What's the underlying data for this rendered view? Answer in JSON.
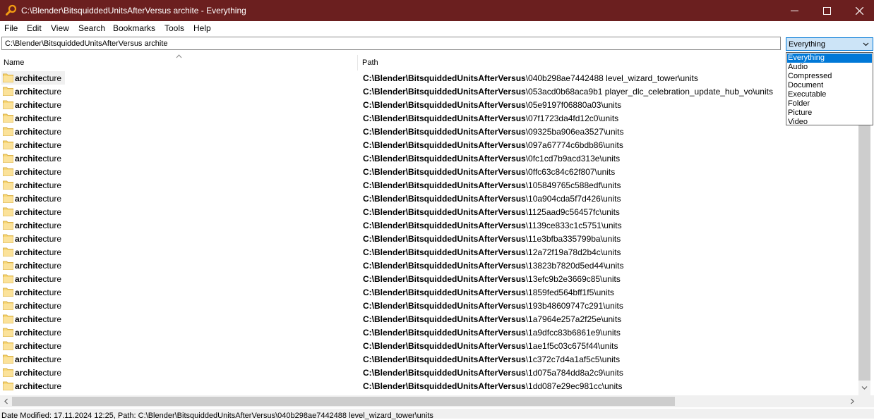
{
  "window": {
    "title": "C:\\Blender\\BitsquiddedUnitsAfterVersus archite - Everything",
    "minimize_label": "—",
    "maximize_label": "☐",
    "close_label": "✕",
    "icon": "search-magnifier-icon",
    "accent_color": "#6b1f1f"
  },
  "menu": {
    "items": [
      "File",
      "Edit",
      "View",
      "Search",
      "Bookmarks",
      "Tools",
      "Help"
    ]
  },
  "search": {
    "value": "C:\\Blender\\BitsquiddedUnitsAfterVersus archite"
  },
  "filter": {
    "selected": "Everything",
    "options": [
      "Everything",
      "Audio",
      "Compressed",
      "Document",
      "Executable",
      "Folder",
      "Picture",
      "Video"
    ]
  },
  "columns": {
    "name": "Name",
    "path": "Path"
  },
  "rows": [
    {
      "name_match": "archite",
      "name_rest": "cture",
      "path_match": "C:\\Blender\\BitsquiddedUnitsAfterVersus",
      "path_rest": "\\040b298ae7442488 level_wizard_tower\\units"
    },
    {
      "name_match": "archite",
      "name_rest": "cture",
      "path_match": "C:\\Blender\\BitsquiddedUnitsAfterVersus",
      "path_rest": "\\053acd0b68aca9b1 player_dlc_celebration_update_hub_vo\\units"
    },
    {
      "name_match": "archite",
      "name_rest": "cture",
      "path_match": "C:\\Blender\\BitsquiddedUnitsAfterVersus",
      "path_rest": "\\05e9197f06880a03\\units"
    },
    {
      "name_match": "archite",
      "name_rest": "cture",
      "path_match": "C:\\Blender\\BitsquiddedUnitsAfterVersus",
      "path_rest": "\\07f1723da4fd12c0\\units"
    },
    {
      "name_match": "archite",
      "name_rest": "cture",
      "path_match": "C:\\Blender\\BitsquiddedUnitsAfterVersus",
      "path_rest": "\\09325ba906ea3527\\units"
    },
    {
      "name_match": "archite",
      "name_rest": "cture",
      "path_match": "C:\\Blender\\BitsquiddedUnitsAfterVersus",
      "path_rest": "\\097a67774c6bdb86\\units"
    },
    {
      "name_match": "archite",
      "name_rest": "cture",
      "path_match": "C:\\Blender\\BitsquiddedUnitsAfterVersus",
      "path_rest": "\\0fc1cd7b9acd313e\\units"
    },
    {
      "name_match": "archite",
      "name_rest": "cture",
      "path_match": "C:\\Blender\\BitsquiddedUnitsAfterVersus",
      "path_rest": "\\0ffc63c84c62f807\\units"
    },
    {
      "name_match": "archite",
      "name_rest": "cture",
      "path_match": "C:\\Blender\\BitsquiddedUnitsAfterVersus",
      "path_rest": "\\105849765c588edf\\units"
    },
    {
      "name_match": "archite",
      "name_rest": "cture",
      "path_match": "C:\\Blender\\BitsquiddedUnitsAfterVersus",
      "path_rest": "\\10a904cda5f7d426\\units"
    },
    {
      "name_match": "archite",
      "name_rest": "cture",
      "path_match": "C:\\Blender\\BitsquiddedUnitsAfterVersus",
      "path_rest": "\\1125aad9c56457fc\\units"
    },
    {
      "name_match": "archite",
      "name_rest": "cture",
      "path_match": "C:\\Blender\\BitsquiddedUnitsAfterVersus",
      "path_rest": "\\1139ce833c1c5751\\units"
    },
    {
      "name_match": "archite",
      "name_rest": "cture",
      "path_match": "C:\\Blender\\BitsquiddedUnitsAfterVersus",
      "path_rest": "\\11e3bfba335799ba\\units"
    },
    {
      "name_match": "archite",
      "name_rest": "cture",
      "path_match": "C:\\Blender\\BitsquiddedUnitsAfterVersus",
      "path_rest": "\\12a72f19a78d2b4c\\units"
    },
    {
      "name_match": "archite",
      "name_rest": "cture",
      "path_match": "C:\\Blender\\BitsquiddedUnitsAfterVersus",
      "path_rest": "\\13823b7820d5ed44\\units"
    },
    {
      "name_match": "archite",
      "name_rest": "cture",
      "path_match": "C:\\Blender\\BitsquiddedUnitsAfterVersus",
      "path_rest": "\\13efc9b2e3669c85\\units"
    },
    {
      "name_match": "archite",
      "name_rest": "cture",
      "path_match": "C:\\Blender\\BitsquiddedUnitsAfterVersus",
      "path_rest": "\\1859fed564bff1f5\\units"
    },
    {
      "name_match": "archite",
      "name_rest": "cture",
      "path_match": "C:\\Blender\\BitsquiddedUnitsAfterVersus",
      "path_rest": "\\193b48609747c291\\units"
    },
    {
      "name_match": "archite",
      "name_rest": "cture",
      "path_match": "C:\\Blender\\BitsquiddedUnitsAfterVersus",
      "path_rest": "\\1a7964e257a2f25e\\units"
    },
    {
      "name_match": "archite",
      "name_rest": "cture",
      "path_match": "C:\\Blender\\BitsquiddedUnitsAfterVersus",
      "path_rest": "\\1a9dfcc83b6861e9\\units"
    },
    {
      "name_match": "archite",
      "name_rest": "cture",
      "path_match": "C:\\Blender\\BitsquiddedUnitsAfterVersus",
      "path_rest": "\\1ae1f5c03c675f44\\units"
    },
    {
      "name_match": "archite",
      "name_rest": "cture",
      "path_match": "C:\\Blender\\BitsquiddedUnitsAfterVersus",
      "path_rest": "\\1c372c7d4a1af5c5\\units"
    },
    {
      "name_match": "archite",
      "name_rest": "cture",
      "path_match": "C:\\Blender\\BitsquiddedUnitsAfterVersus",
      "path_rest": "\\1d075a784dd8a2c9\\units"
    },
    {
      "name_match": "archite",
      "name_rest": "cture",
      "path_match": "C:\\Blender\\BitsquiddedUnitsAfterVersus",
      "path_rest": "\\1dd087e29ec981cc\\units"
    }
  ],
  "status": {
    "text": "Date Modified: 17.11.2024 12:25, Path: C:\\Blender\\BitsquiddedUnitsAfterVersus\\040b298ae7442488 level_wizard_tower\\units"
  }
}
